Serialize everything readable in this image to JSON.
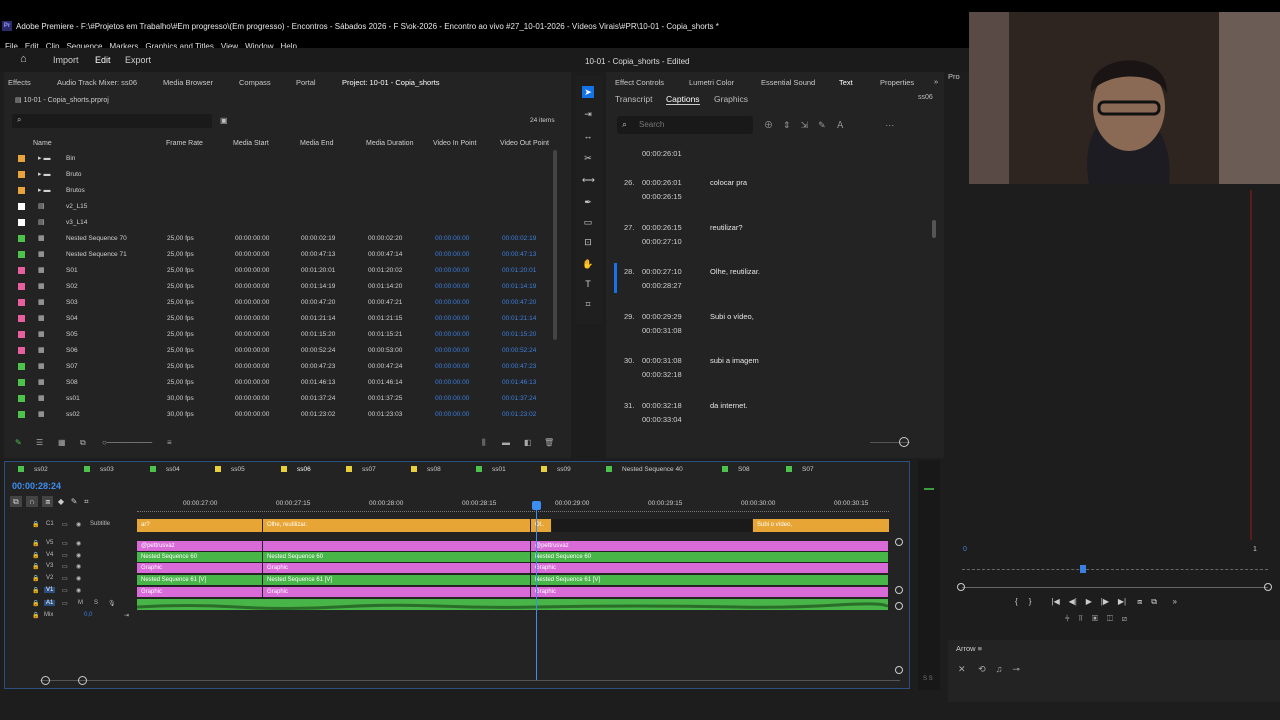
{
  "window": {
    "title": "Adobe Premiere - F:\\#Projetos em Trabalho\\#Em progresso\\(Em progresso) - Encontros - Sábados 2026 - F S\\ok-2026 - Encontro ao vivo #27_10-01-2026 - Vídeos Virais\\#PR\\10-01 - Copia_shorts *",
    "logo": "Pr"
  },
  "menu": [
    "File",
    "Edit",
    "Clip",
    "Sequence",
    "Markers",
    "Graphics and Titles",
    "View",
    "Window",
    "Help"
  ],
  "header": {
    "import": "Import",
    "edit": "Edit",
    "export": "Export",
    "document": "10-01 - Copia_shorts - Edited"
  },
  "project_panel": {
    "tabs": [
      "Effects",
      "Audio Track Mixer: ss06",
      "Media Browser",
      "Compass",
      "Portal",
      "Project: 10-01 - Copia_shorts"
    ],
    "file": "10-01 - Copia_shorts.prproj",
    "items_count": "24 items",
    "columns": [
      "Name",
      "Frame Rate",
      "Media Start",
      "Media End",
      "Media Duration",
      "Video In Point",
      "Video Out Point"
    ],
    "rows": [
      {
        "color": "#e8a33c",
        "name": "Bin",
        "type": "bin"
      },
      {
        "color": "#e8a33c",
        "name": "Bruto",
        "type": "bin"
      },
      {
        "color": "#e8a33c",
        "name": "Brutos",
        "type": "bin"
      },
      {
        "color": "#ffffff",
        "name": "v2_L15",
        "type": "item"
      },
      {
        "color": "#ffffff",
        "name": "v3_L14",
        "type": "item"
      },
      {
        "color": "#4cc44c",
        "name": "Nested Sequence 70",
        "fr": "25,00 fps",
        "ms": "00:00:00:00",
        "me": "00:00:02:19",
        "md": "00:00:02:20",
        "vi": "00:00:00:00",
        "vo": "00:00:02:19"
      },
      {
        "color": "#4cc44c",
        "name": "Nested Sequence 71",
        "fr": "25,00 fps",
        "ms": "00:00:00:00",
        "me": "00:00:47:13",
        "md": "00:00:47:14",
        "vi": "00:00:00:00",
        "vo": "00:00:47:13"
      },
      {
        "color": "#e85fa0",
        "name": "S01",
        "fr": "25,00 fps",
        "ms": "00:00:00:00",
        "me": "00:01:20:01",
        "md": "00:01:20:02",
        "vi": "00:00:00:00",
        "vo": "00:01:20:01"
      },
      {
        "color": "#e85fa0",
        "name": "S02",
        "fr": "25,00 fps",
        "ms": "00:00:00:00",
        "me": "00:01:14:19",
        "md": "00:01:14:20",
        "vi": "00:00:00:00",
        "vo": "00:01:14:19"
      },
      {
        "color": "#e85fa0",
        "name": "S03",
        "fr": "25,00 fps",
        "ms": "00:00:00:00",
        "me": "00:00:47:20",
        "md": "00:00:47:21",
        "vi": "00:00:00:00",
        "vo": "00:00:47:20"
      },
      {
        "color": "#e85fa0",
        "name": "S04",
        "fr": "25,00 fps",
        "ms": "00:00:00:00",
        "me": "00:01:21:14",
        "md": "00:01:21:15",
        "vi": "00:00:00:00",
        "vo": "00:01:21:14"
      },
      {
        "color": "#e85fa0",
        "name": "S05",
        "fr": "25,00 fps",
        "ms": "00:00:00:00",
        "me": "00:01:15:20",
        "md": "00:01:15:21",
        "vi": "00:00:00:00",
        "vo": "00:01:15:20"
      },
      {
        "color": "#e85fa0",
        "name": "S06",
        "fr": "25,00 fps",
        "ms": "00:00:00:00",
        "me": "00:00:52:24",
        "md": "00:00:53:00",
        "vi": "00:00:00:00",
        "vo": "00:00:52:24"
      },
      {
        "color": "#4cc44c",
        "name": "S07",
        "fr": "25,00 fps",
        "ms": "00:00:00:00",
        "me": "00:00:47:23",
        "md": "00:00:47:24",
        "vi": "00:00:00:00",
        "vo": "00:00:47:23"
      },
      {
        "color": "#4cc44c",
        "name": "S08",
        "fr": "25,00 fps",
        "ms": "00:00:00:00",
        "me": "00:01:46:13",
        "md": "00:01:46:14",
        "vi": "00:00:00:00",
        "vo": "00:01:46:13"
      },
      {
        "color": "#4cc44c",
        "name": "ss01",
        "fr": "30,00 fps",
        "ms": "00:00:00:00",
        "me": "00:01:37:24",
        "md": "00:01:37:25",
        "vi": "00:00:00:00",
        "vo": "00:01:37:24"
      },
      {
        "color": "#4cc44c",
        "name": "ss02",
        "fr": "30,00 fps",
        "ms": "00:00:00:00",
        "me": "00:01:23:02",
        "md": "00:01:23:03",
        "vi": "00:00:00:00",
        "vo": "00:01:23:02"
      }
    ]
  },
  "text_panel": {
    "tabs": [
      "Effect Controls",
      "Lumetri Color",
      "Essential Sound",
      "Text",
      "Properties"
    ],
    "subtabs": [
      "Transcript",
      "Captions",
      "Graphics"
    ],
    "seq": "ss06",
    "search_placeholder": "Search",
    "first_time": "00:00:26:01",
    "captions": [
      {
        "n": "26.",
        "in": "00:00:26:01",
        "out": "00:00:26:15",
        "text": "colocar pra"
      },
      {
        "n": "27.",
        "in": "00:00:26:15",
        "out": "00:00:27:10",
        "text": "reutilizar?"
      },
      {
        "n": "28.",
        "in": "00:00:27:10",
        "out": "00:00:28:27",
        "text": "Olhe, reutilizar."
      },
      {
        "n": "29.",
        "in": "00:00:29:29",
        "out": "00:00:31:08",
        "text": "Subi o vídeo,"
      },
      {
        "n": "30.",
        "in": "00:00:31:08",
        "out": "00:00:32:18",
        "text": "subi a imagem"
      },
      {
        "n": "31.",
        "in": "00:00:32:18",
        "out": "00:00:33:04",
        "text": "da internet."
      }
    ]
  },
  "timeline": {
    "tabs": [
      {
        "name": "ss02",
        "color": "#4cc44c"
      },
      {
        "name": "ss03",
        "color": "#4cc44c"
      },
      {
        "name": "ss04",
        "color": "#4cc44c"
      },
      {
        "name": "ss05",
        "color": "#e8d03c"
      },
      {
        "name": "ss06",
        "color": "#e8d03c"
      },
      {
        "name": "ss07",
        "color": "#e8d03c"
      },
      {
        "name": "ss08",
        "color": "#e8d03c"
      },
      {
        "name": "ss01",
        "color": "#4cc44c"
      },
      {
        "name": "ss09",
        "color": "#e8d03c"
      },
      {
        "name": "Nested Sequence 40",
        "color": "#4cc44c"
      },
      {
        "name": "S08",
        "color": "#4cc44c"
      },
      {
        "name": "S07",
        "color": "#4cc44c"
      }
    ],
    "timecode": "00:00:28:24",
    "ruler": [
      "00:00:27:00",
      "00:00:27:15",
      "00:00:28:00",
      "00:00:28:15",
      "00:00:29:00",
      "00:00:29:15",
      "00:00:30:00",
      "00:00:30:15"
    ],
    "tracks": [
      "Subtitle",
      "V5",
      "V4",
      "V3",
      "V2",
      "V1",
      "A1",
      "Mix"
    ],
    "mix_value": "0,0",
    "subtitle_clips": [
      "ar?",
      "Olhe, reutilizar.",
      "Ol..",
      "Subi o vídeo,"
    ],
    "v5": "@pettrusvaz",
    "v4": "Nested Sequence 60",
    "v3": "Graphic",
    "v2": "Nested Sequence 61 [V]",
    "v1": "Graphic"
  },
  "program": {
    "in_num": "0",
    "out_num": "1",
    "panel_label": "Pro",
    "bottom_label": "Arrow"
  }
}
